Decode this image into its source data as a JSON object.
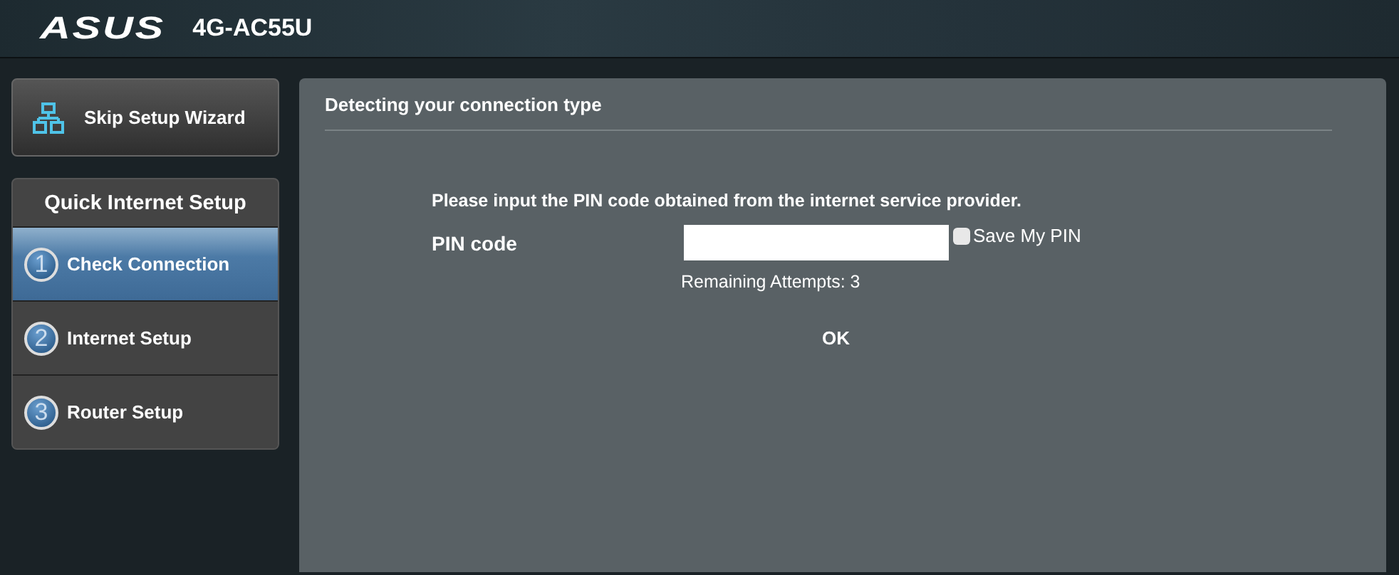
{
  "header": {
    "logo": "ASUS",
    "model": "4G-AC55U"
  },
  "skip_button": {
    "label": "Skip Setup Wizard"
  },
  "sidebar": {
    "title": "Quick Internet Setup",
    "items": [
      {
        "number": "1",
        "label": "Check Connection",
        "selected": true
      },
      {
        "number": "2",
        "label": "Internet Setup",
        "selected": false
      },
      {
        "number": "3",
        "label": "Router Setup",
        "selected": false
      }
    ]
  },
  "panel": {
    "title": "Detecting your connection type",
    "instruction": "Please input the PIN code obtained from the internet service provider.",
    "pin_label": "PIN code",
    "save_pin": {
      "label": "Save My PIN",
      "checked": false
    },
    "remaining": "Remaining Attempts: 3",
    "ok_button": "OK"
  }
}
